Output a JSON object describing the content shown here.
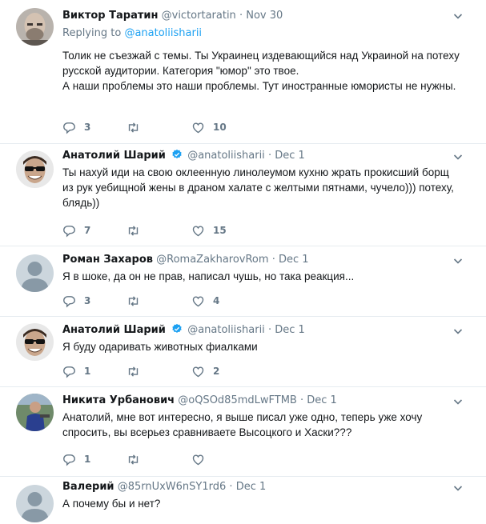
{
  "tweets": [
    {
      "name": "Виктор Таратин",
      "handle": "@victortaratin",
      "sep": "·",
      "date": "Nov 30",
      "verified": false,
      "avatar": "avatar-bald-man",
      "replying_label": "Replying to",
      "replying_mention": "@anatoliisharii",
      "text": "Толик не съезжай с темы. Ты Украинец издевающийся над Украиной на потеху русской аудитории. Категория \"юмор\" это твое.\nА наши проблемы это наши проблемы. Тут иностранные юмористы не нужны.",
      "replies": "3",
      "retweets": "",
      "likes": "10"
    },
    {
      "name": "Анатолий Шарий",
      "handle": "@anatoliisharii",
      "sep": "·",
      "date": "Dec 1",
      "verified": true,
      "avatar": "avatar-sunglasses-man",
      "text": "Ты нахуй иди на свою оклеенную линолеумом кухню жрать прокисший борщ из рук уебищной жены в драном халате с желтыми пятнами, чучело))) потеху, блядь))",
      "replies": "7",
      "retweets": "",
      "likes": "15"
    },
    {
      "name": "Роман Захаров",
      "handle": "@RomaZakharovRom",
      "sep": "·",
      "date": "Dec 1",
      "verified": false,
      "avatar": "avatar-default",
      "text": "Я в шоке, да он не прав, написал чушь, но така реакция...",
      "replies": "3",
      "retweets": "",
      "likes": "4"
    },
    {
      "name": "Анатолий Шарий",
      "handle": "@anatoliisharii",
      "sep": "·",
      "date": "Dec 1",
      "verified": true,
      "avatar": "avatar-sunglasses-man",
      "text": "Я буду одаривать животных фиалками",
      "replies": "1",
      "retweets": "",
      "likes": "2"
    },
    {
      "name": "Никита Урбанович",
      "handle": "@oQSOd85mdLwFTMB",
      "sep": "·",
      "date": "Dec 1",
      "verified": false,
      "avatar": "avatar-photo-person",
      "text": "Анатолий, мне вот интересно, я выше писал уже одно, теперь уже хочу спросить, вы всерьез сравниваете Высоцкого и Хаски???",
      "replies": "1",
      "retweets": "",
      "likes": ""
    },
    {
      "name": "Валерий",
      "handle": "@85rnUxW6nSY1rd6",
      "sep": "·",
      "date": "Dec 1",
      "verified": false,
      "avatar": "avatar-default",
      "text": "А почему бы и нет?"
    }
  ],
  "icons": {
    "reply": "reply-icon",
    "retweet": "retweet-icon",
    "like": "heart-icon",
    "caret": "chevron-down-icon",
    "verified": "verified-badge-icon"
  },
  "colors": {
    "link": "#1da1f2",
    "secondary_text": "#657786",
    "divider": "#e6ecf0",
    "verified": "#1da1f2"
  }
}
